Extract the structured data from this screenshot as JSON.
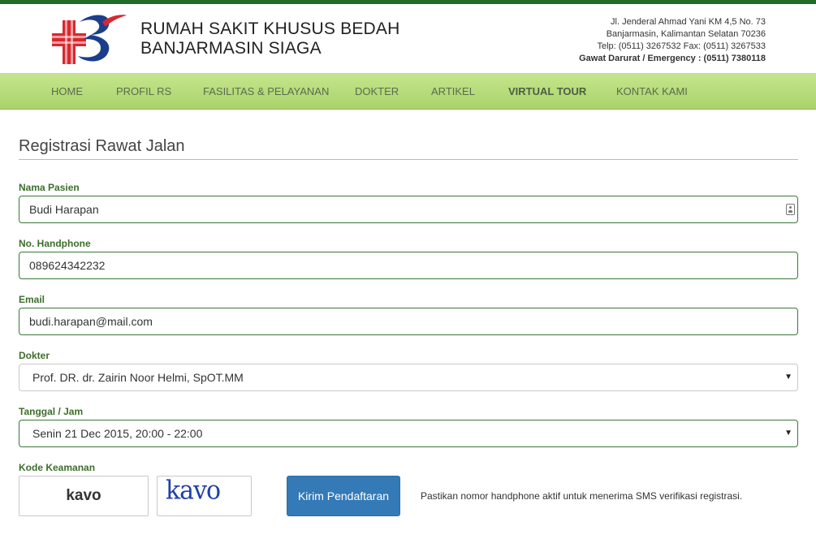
{
  "header": {
    "brand_line1": "RUMAH SAKIT KHUSUS BEDAH",
    "brand_line2": "BANJARMASIN SIAGA",
    "address_line1": "Jl. Jenderal Ahmad Yani KM 4,5 No. 73",
    "address_line2": "Banjarmasin, Kalimantan Selatan 70236",
    "phone_line": "Telp: (0511) 3267532 Fax: (0511) 3267533",
    "emergency_line": "Gawat Darurat / Emergency : (0511) 7380118",
    "logo_icon": "hospital-cross-logo-icon"
  },
  "nav": {
    "items": [
      "HOME",
      "PROFIL RS",
      "FASILITAS & PELAYANAN",
      "DOKTER",
      "ARTIKEL",
      "VIRTUAL TOUR",
      "KONTAK KAMI"
    ]
  },
  "form": {
    "title": "Registrasi Rawat Jalan",
    "name_label": "Nama Pasien",
    "name_value": "Budi Harapan",
    "phone_label": "No. Handphone",
    "phone_value": "089624342232",
    "email_label": "Email",
    "email_value": "budi.harapan@mail.com",
    "doctor_label": "Dokter",
    "doctor_value": "Prof. DR. dr. Zairin Noor Helmi, SpOT.MM",
    "datetime_label": "Tanggal / Jam",
    "datetime_value": "Senin 21 Dec 2015, 20:00 - 22:00",
    "captcha_label": "Kode Keamanan",
    "captcha_value": "kavo",
    "captcha_image_text": "kavo",
    "submit_label": "Kirim Pendaftaran",
    "hint": "Pastikan nomor handphone aktif untuk menerima SMS verifikasi registrasi."
  },
  "colors": {
    "top_bar": "#1f6b2a",
    "nav_background": "#b6dc7a",
    "label_green": "#3c6e2c",
    "field_border_green": "#3c763d",
    "submit_blue": "#337ab7"
  }
}
